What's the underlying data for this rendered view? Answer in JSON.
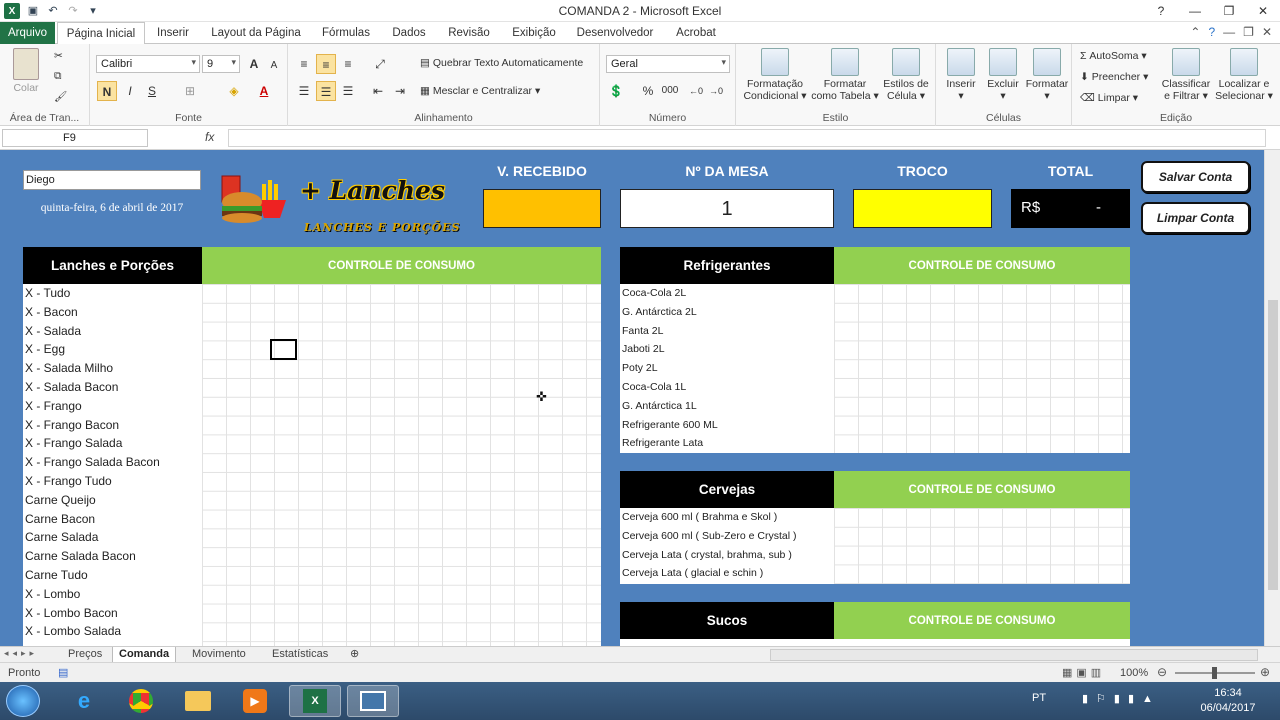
{
  "window": {
    "title": "COMANDA 2  -  Microsoft Excel"
  },
  "ribbon_tabs": [
    "Arquivo",
    "Página Inicial",
    "Inserir",
    "Layout da Página",
    "Fórmulas",
    "Dados",
    "Revisão",
    "Exibição",
    "Desenvolvedor",
    "Acrobat"
  ],
  "ribbon": {
    "clipboard": {
      "paste": "Colar",
      "label": "Área de Tran..."
    },
    "font": {
      "name": "Calibri",
      "size": "9",
      "bold": "N",
      "italic": "I",
      "underline": "S",
      "grow": "A",
      "shrink": "A",
      "color_letter": "A",
      "label": "Fonte"
    },
    "alignment": {
      "wrap": "Quebrar Texto Automaticamente",
      "merge": "Mesclar e Centralizar",
      "label": "Alinhamento"
    },
    "number": {
      "format": "Geral",
      "percent": "%",
      "thousands": "000",
      "label": "Número"
    },
    "styles": {
      "cond1": "Formatação",
      "cond2": "Condicional",
      "table1": "Formatar",
      "table2": "como Tabela",
      "cell1": "Estilos de",
      "cell2": "Célula",
      "label": "Estilo"
    },
    "cells": {
      "insert": "Inserir",
      "delete": "Excluir",
      "format": "Formatar",
      "label": "Células"
    },
    "editing": {
      "autosum": "AutoSoma",
      "fill": "Preencher",
      "clear": "Limpar",
      "sort1": "Classificar",
      "sort2": "e Filtrar",
      "find1": "Localizar e",
      "find2": "Selecionar",
      "label": "Edição"
    }
  },
  "formula_bar": {
    "name_box": "F9",
    "fx": "fx",
    "value": ""
  },
  "sheet": {
    "user": "Diego",
    "date": "quinta-feira, 6 de abril de 2017",
    "logo_title": "+ Lanches",
    "logo_subtitle": "LANCHES E PORÇÕES",
    "v_recebido_label": "V. RECEBIDO",
    "mesa_label": "Nº DA MESA",
    "mesa_value": "1",
    "troco_label": "TROCO",
    "total_label": "TOTAL",
    "total_currency": "R$",
    "total_value": "-",
    "btn_save": "Salvar  Conta",
    "btn_clear": "Limpar Conta",
    "colors": {
      "background": "#4f81bd",
      "recebido": "#ffc000",
      "troco": "#ffff00",
      "header_green": "#92d050"
    },
    "lanches": {
      "title": "Lanches e Porções",
      "control": "CONTROLE DE CONSUMO",
      "items": [
        "X - Tudo",
        "X - Bacon",
        "X - Salada",
        "X - Egg",
        "X - Salada Milho",
        "X - Salada Bacon",
        "X - Frango",
        "X - Frango Bacon",
        "X - Frango Salada",
        "X - Frango Salada Bacon",
        "X - Frango Tudo",
        "Carne Queijo",
        "Carne Bacon",
        "Carne Salada",
        "Carne Salada Bacon",
        "Carne Tudo",
        "X - Lombo",
        "X - Lombo Bacon",
        "X - Lombo Salada"
      ]
    },
    "refrigerantes": {
      "title": "Refrigerantes",
      "control": "CONTROLE DE CONSUMO",
      "items": [
        "Coca-Cola 2L",
        "G. Antárctica 2L",
        "Fanta 2L",
        "Jaboti 2L",
        "Poty 2L",
        "Coca-Cola 1L",
        "G. Antárctica 1L",
        "Refrigerante 600 ML",
        "Refrigerante Lata"
      ]
    },
    "cervejas": {
      "title": "Cervejas",
      "control": "CONTROLE DE CONSUMO",
      "items": [
        "Cerveja 600 ml  ( Brahma e Skol )",
        "Cerveja 600 ml  ( Sub-Zero e Crystal )",
        "Cerveja Lata      ( crystal, brahma, sub )",
        "Cerveja Lata      ( glacial e schin )"
      ]
    },
    "sucos": {
      "title": "Sucos",
      "control": "CONTROLE DE CONSUMO"
    }
  },
  "sheet_tabs": [
    "Preços",
    "Comanda",
    "Movimento",
    "Estatísticas"
  ],
  "active_sheet": "Comanda",
  "status": {
    "ready": "Pronto",
    "zoom": "100%"
  },
  "taskbar": {
    "lang": "PT",
    "time": "16:34",
    "date": "06/04/2017"
  }
}
